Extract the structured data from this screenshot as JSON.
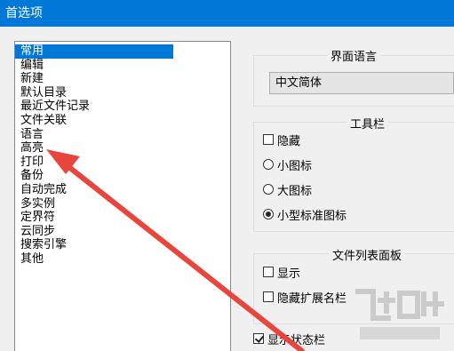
{
  "window": {
    "title": "首选项"
  },
  "categories": [
    {
      "label": "常用",
      "selected": true
    },
    {
      "label": "编辑"
    },
    {
      "label": "新建"
    },
    {
      "label": "默认目录"
    },
    {
      "label": "最近文件记录"
    },
    {
      "label": "文件关联"
    },
    {
      "label": "语言"
    },
    {
      "label": "高亮"
    },
    {
      "label": "打印"
    },
    {
      "label": "备份"
    },
    {
      "label": "自动完成"
    },
    {
      "label": "多实例"
    },
    {
      "label": "定界符"
    },
    {
      "label": "云同步"
    },
    {
      "label": "搜索引擎"
    },
    {
      "label": "其他"
    }
  ],
  "interface_language": {
    "title": "界面语言",
    "selected_value": "中文简体"
  },
  "toolbar": {
    "title": "工具栏",
    "hide_label": "隐藏",
    "hide_checked": false,
    "options": [
      {
        "label": "小图标",
        "checked": false
      },
      {
        "label": "大图标",
        "checked": false
      },
      {
        "label": "小型标准图标",
        "checked": true
      }
    ]
  },
  "file_list_panel": {
    "title": "文件列表面板",
    "show_label": "显示",
    "show_checked": false,
    "hide_ext_label": "隐藏扩展名栏",
    "hide_ext_checked": false
  },
  "status_bar": {
    "label": "显示状态栏",
    "checked": true
  },
  "colors": {
    "accent": "#0078d7",
    "arrow": "#e8453c"
  },
  "annotation": {
    "arrow_target": "高亮"
  },
  "watermark_icon": "download-site-logo"
}
